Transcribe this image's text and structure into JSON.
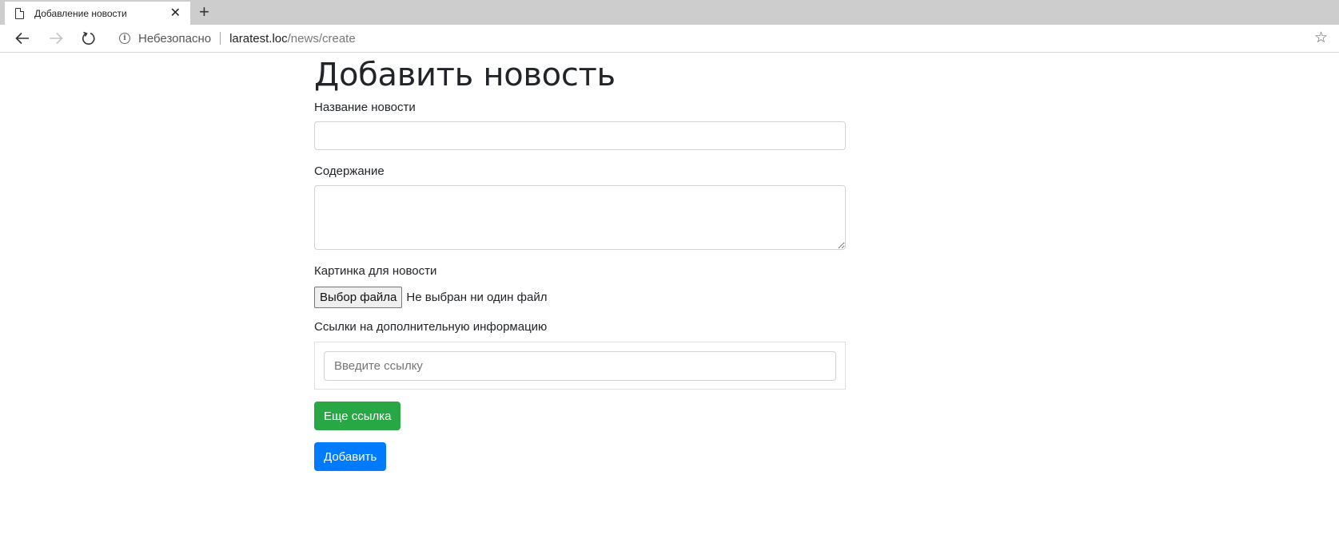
{
  "browser": {
    "tab_title": "Добавление новости",
    "tab_close": "✕",
    "new_tab": "+",
    "security_label": "Небезопасно",
    "url_host": "laratest.loc",
    "url_path": "/news/create",
    "bookmark_star": "☆"
  },
  "page": {
    "heading": "Добавить новость",
    "fields": {
      "title_label": "Название новости",
      "title_value": "",
      "content_label": "Содержание",
      "content_value": "",
      "image_label": "Картинка для новости",
      "file_button": "Выбор файла",
      "file_status": "Не выбран ни один файл",
      "links_label": "Ссылки на дополнительную информацию",
      "link_placeholder": "Введите ссылку"
    },
    "buttons": {
      "more_link": "Еще ссылка",
      "submit": "Добавить"
    }
  },
  "colors": {
    "success": "#28a745",
    "primary": "#007bff",
    "tabstrip": "#cdcdcd"
  }
}
